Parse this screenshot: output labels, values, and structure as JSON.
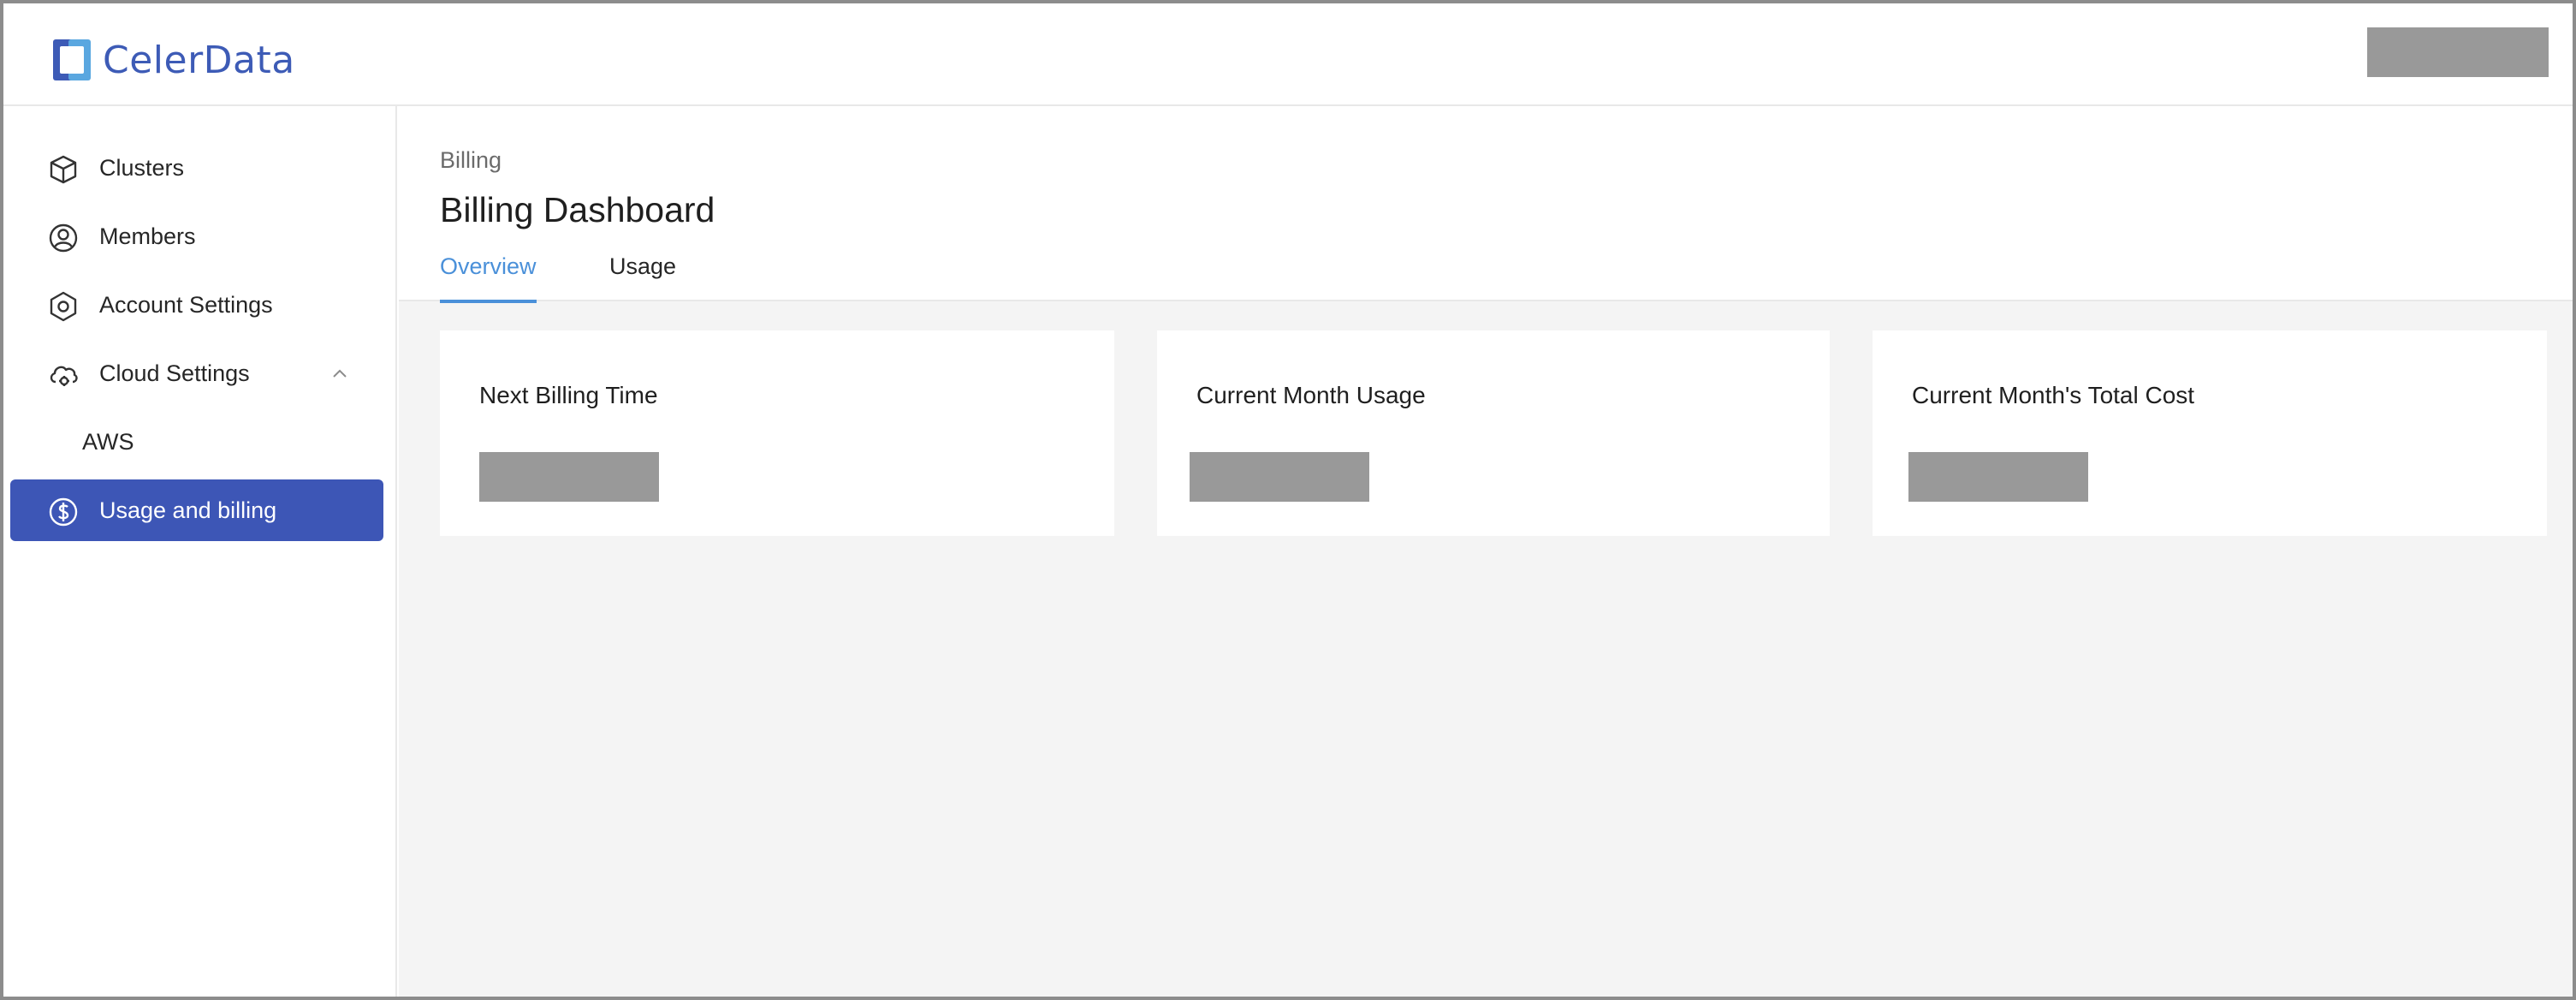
{
  "header": {
    "logo_text": "CelerData",
    "brand_color": "#3d5bb6"
  },
  "sidebar": {
    "items": [
      {
        "label": "Clusters",
        "icon": "cube-icon"
      },
      {
        "label": "Members",
        "icon": "user-circle-icon"
      },
      {
        "label": "Account Settings",
        "icon": "hexagon-settings-icon"
      },
      {
        "label": "Cloud Settings",
        "icon": "cloud-gear-icon",
        "expanded": true
      },
      {
        "label": "AWS",
        "icon": null
      },
      {
        "label": "Usage and billing",
        "icon": "dollar-circle-icon",
        "active": true
      }
    ],
    "active_color": "#3d56b6"
  },
  "main": {
    "breadcrumb": "Billing",
    "title": "Billing Dashboard",
    "tabs": [
      {
        "label": "Overview",
        "active": true
      },
      {
        "label": "Usage",
        "active": false
      }
    ],
    "cards": [
      {
        "title": "Next Billing Time"
      },
      {
        "title": "Current Month Usage"
      },
      {
        "title": "Current Month's Total Cost"
      }
    ],
    "tab_active_color": "#4a90d9"
  }
}
